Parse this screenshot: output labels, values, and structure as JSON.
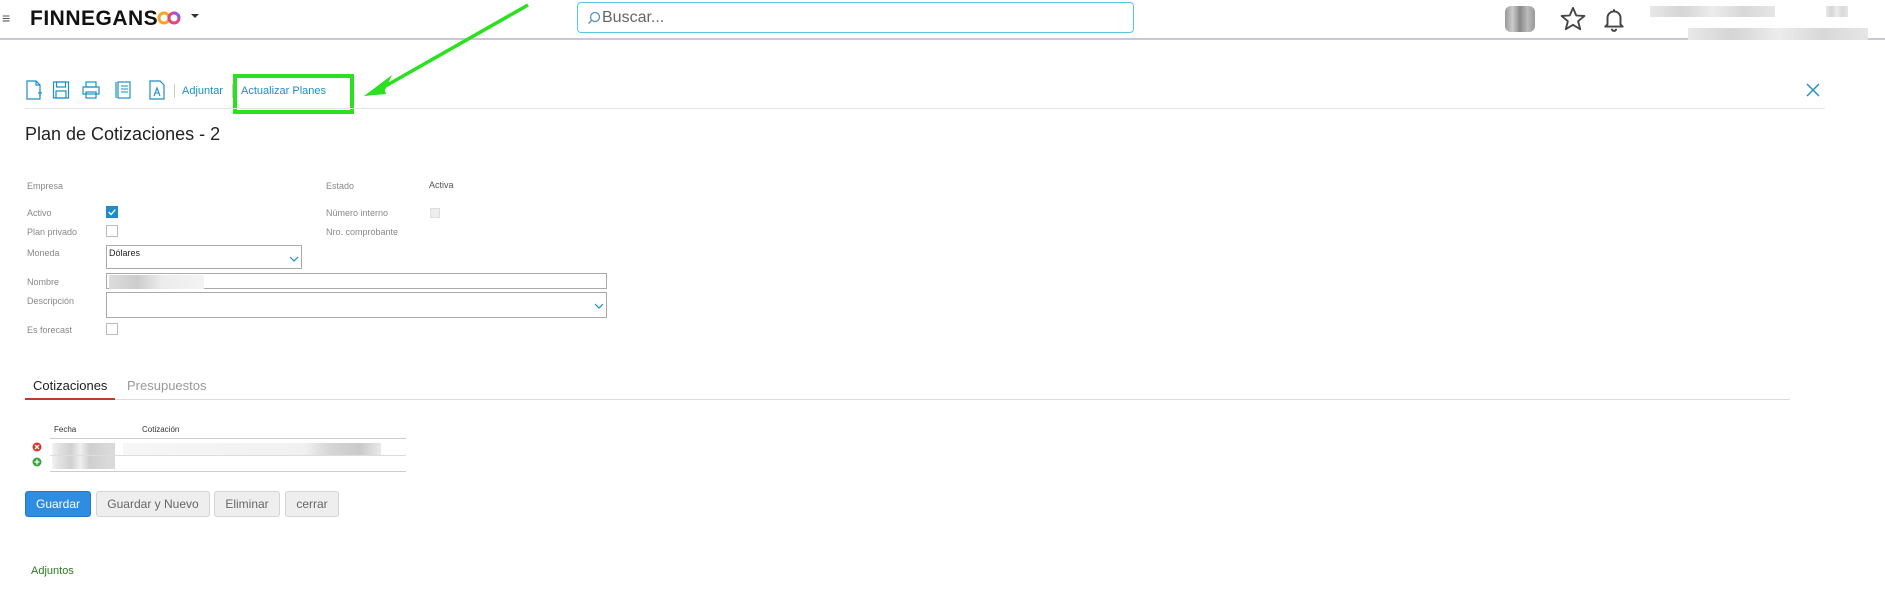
{
  "header": {
    "menu_icon": "≡",
    "logo_text": "FINNEGANS",
    "search_placeholder": "Buscar..."
  },
  "toolbar": {
    "icons": [
      "new-document-icon",
      "save-icon",
      "print-icon",
      "report-icon",
      "text-format-icon"
    ],
    "adjuntar_label": "Adjuntar",
    "actualizar_label": "Actualizar Planes"
  },
  "page": {
    "title": "Plan de Cotizaciones - 2"
  },
  "form": {
    "empresa_label": "Empresa",
    "estado_label": "Estado",
    "estado_value": "Activa",
    "activo_label": "Activo",
    "activo_checked": true,
    "numero_interno_label": "Número interno",
    "plan_privado_label": "Plan privado",
    "nro_comprobante_label": "Nro. comprobante",
    "moneda_label": "Moneda",
    "moneda_value": "Dólares",
    "nombre_label": "Nombre",
    "descripcion_label": "Descripción",
    "es_forecast_label": "Es forecast"
  },
  "tabs": [
    {
      "label": "Cotizaciones",
      "active": true
    },
    {
      "label": "Presupuestos",
      "active": false
    }
  ],
  "grid": {
    "col_fecha": "Fecha",
    "col_cotizacion": "Cotización"
  },
  "buttons": {
    "guardar": "Guardar",
    "guardar_nuevo": "Guardar y Nuevo",
    "eliminar": "Eliminar",
    "cerrar": "cerrar"
  },
  "adjuntos_label": "Adjuntos",
  "colors": {
    "accent": "#1d8ec6",
    "primary_button": "#2e8de0",
    "highlight": "#2be01f",
    "active_tab_underline": "#c0392b"
  }
}
